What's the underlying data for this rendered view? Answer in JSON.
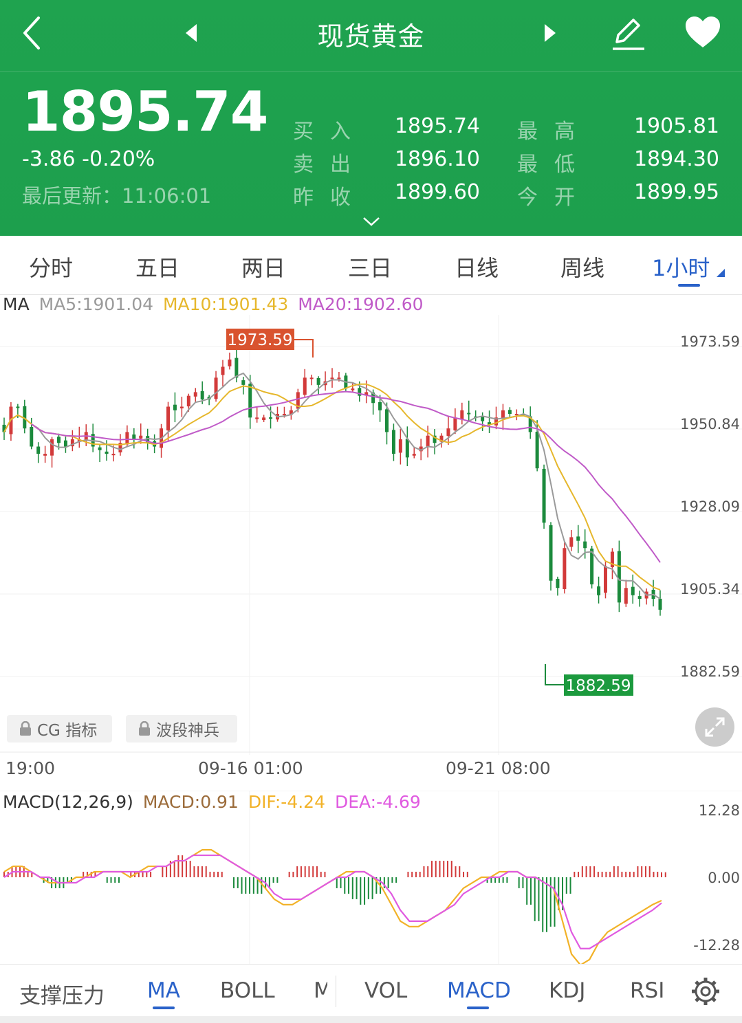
{
  "header": {
    "title": "现货黄金",
    "price": "1895.74",
    "change": "-3.86  -0.20%",
    "update_label": "最后更新：11:06:01",
    "quotes": [
      {
        "label": "买入",
        "value": "1895.74"
      },
      {
        "label": "卖出",
        "value": "1896.10"
      },
      {
        "label": "昨收",
        "value": "1899.60"
      },
      {
        "label": "最高",
        "value": "1905.81"
      },
      {
        "label": "最低",
        "value": "1894.30"
      },
      {
        "label": "今开",
        "value": "1899.95"
      }
    ]
  },
  "period_tabs": [
    "分时",
    "五日",
    "两日",
    "三日",
    "日线",
    "周线",
    "1小时"
  ],
  "active_period": "1小时",
  "ma_legend": {
    "name": "MA",
    "ma5": "MA5:1901.04",
    "ma10": "MA10:1901.43",
    "ma20": "MA20:1902.60"
  },
  "main_chart": {
    "max_marker": "1973.59",
    "min_marker": "1882.59",
    "y_ticks": [
      "1973.59",
      "1950.84",
      "1928.09",
      "1905.34",
      "1882.59"
    ],
    "x_labels": [
      "19:00",
      "09-16 01:00",
      "09-21 08:00"
    ],
    "lock_buttons": [
      "CG 指标",
      "波段神兵"
    ]
  },
  "macd_legend": {
    "name": "MACD(12,26,9)",
    "macd": "MACD:0.91",
    "dif": "DIF:-4.24",
    "dea": "DEA:-4.69"
  },
  "macd_chart": {
    "y_ticks": [
      "12.28",
      "0.00",
      "-12.28"
    ]
  },
  "bottom_tabs": [
    "支撑压力",
    "MA",
    "BOLL",
    "M",
    "VOL",
    "MACD",
    "KDJ",
    "RSI"
  ],
  "colors": {
    "header_green": "#1fa34f",
    "up": "#d23a3a",
    "down": "#1b8a3c",
    "ma5": "#9a9a9a",
    "ma10": "#e6b72c",
    "ma20": "#c05bc8",
    "accent": "#2a62c9"
  },
  "chart_data": [
    {
      "type": "candlestick",
      "title": "",
      "ylim": [
        1882.59,
        1973.59
      ],
      "y_ticks": [
        1973.59,
        1950.84,
        1928.09,
        1905.34,
        1882.59
      ],
      "x_labels": [
        "19:00",
        "09-16 01:00",
        "09-21 08:00"
      ],
      "marked_high": 1973.59,
      "marked_low": 1882.59,
      "close_series": [
        1950,
        1957,
        1957,
        1951,
        1946,
        1944,
        1944,
        1948,
        1947,
        1946,
        1948,
        1948,
        1950,
        1946,
        1945,
        1944,
        1944,
        1947,
        1950,
        1948,
        1949,
        1947,
        1946,
        1951,
        1957,
        1956,
        1957,
        1960,
        1961,
        1959,
        1959,
        1965,
        1968,
        1970,
        1965,
        1963,
        1954,
        1954,
        1954,
        1954,
        1955,
        1955,
        1956,
        1961,
        1965,
        1965,
        1963,
        1964,
        1965,
        1965,
        1962,
        1962,
        1960,
        1961,
        1958,
        1956,
        1950,
        1944,
        1948,
        1943,
        1944,
        1946,
        1949,
        1947,
        1949,
        1951,
        1954,
        1956,
        1955,
        1954,
        1953,
        1952,
        1954,
        1956,
        1955,
        1955,
        1955,
        1950,
        1940,
        1925,
        1909,
        1907,
        1918,
        1921,
        1920,
        1918,
        1908,
        1905,
        1913,
        1917,
        1903,
        1907,
        1905,
        1904,
        1906,
        1904,
        1901
      ],
      "series": [
        {
          "name": "MA5",
          "value": 1901.04
        },
        {
          "name": "MA10",
          "value": 1901.43
        },
        {
          "name": "MA20",
          "value": 1902.6
        }
      ]
    },
    {
      "type": "bar",
      "title": "MACD(12,26,9)",
      "ylim": [
        -12.28,
        12.28
      ],
      "y_ticks": [
        12.28,
        0.0,
        -12.28
      ],
      "macd_values": [
        1,
        2,
        2,
        1,
        0,
        -1,
        -2,
        -2,
        -1,
        0,
        1,
        1,
        0,
        -1,
        -1,
        0,
        1,
        1,
        1,
        0,
        2,
        3,
        4,
        3,
        2,
        2,
        1,
        1,
        0,
        -2,
        -3,
        -3,
        -3,
        -2,
        -1,
        0,
        1,
        2,
        2,
        2,
        1,
        0,
        -2,
        -3,
        -4,
        -5,
        -4,
        -3,
        -2,
        -1,
        0,
        1,
        1,
        2,
        3,
        3,
        3,
        2,
        1,
        0,
        0,
        -1,
        -1,
        -1,
        0,
        -2,
        -5,
        -8,
        -10,
        -9,
        -6,
        -3,
        1,
        2,
        2,
        1,
        1,
        2,
        1,
        1,
        2,
        2,
        1,
        0.91
      ],
      "series": [
        {
          "name": "MACD",
          "value": 0.91
        },
        {
          "name": "DIF",
          "value": -4.24,
          "values": [
            1,
            2,
            2,
            1,
            0,
            -1,
            -1,
            -1,
            0,
            0,
            1,
            1,
            1,
            1,
            0,
            1,
            2,
            2,
            2,
            3,
            3,
            4,
            5,
            5,
            4,
            3,
            2,
            1,
            0,
            -2,
            -4,
            -5,
            -5,
            -4,
            -3,
            -2,
            -1,
            0,
            1,
            1,
            1,
            0,
            -2,
            -5,
            -8,
            -9,
            -9,
            -8,
            -7,
            -6,
            -4,
            -2,
            -1,
            0,
            0,
            1,
            1,
            1,
            0,
            0,
            -1,
            -2,
            -8,
            -14,
            -16,
            -15,
            -12,
            -10,
            -9,
            -8,
            -7,
            -6,
            -5,
            -4.24
          ]
        },
        {
          "name": "DEA",
          "value": -4.69,
          "values": [
            0,
            1,
            1,
            1,
            0,
            0,
            -1,
            -1,
            -1,
            0,
            0,
            1,
            1,
            1,
            1,
            1,
            1,
            2,
            2,
            3,
            3,
            4,
            4,
            4,
            4,
            3,
            2,
            1,
            0,
            -1,
            -3,
            -4,
            -4,
            -4,
            -3,
            -2,
            -1,
            0,
            0,
            1,
            1,
            0,
            -1,
            -3,
            -6,
            -8,
            -8,
            -8,
            -7,
            -6,
            -5,
            -3,
            -2,
            -1,
            0,
            0,
            1,
            1,
            0,
            0,
            -1,
            -2,
            -5,
            -10,
            -13,
            -13,
            -12,
            -11,
            -10,
            -9,
            -8,
            -7,
            -6,
            -4.69
          ]
        }
      ]
    }
  ]
}
